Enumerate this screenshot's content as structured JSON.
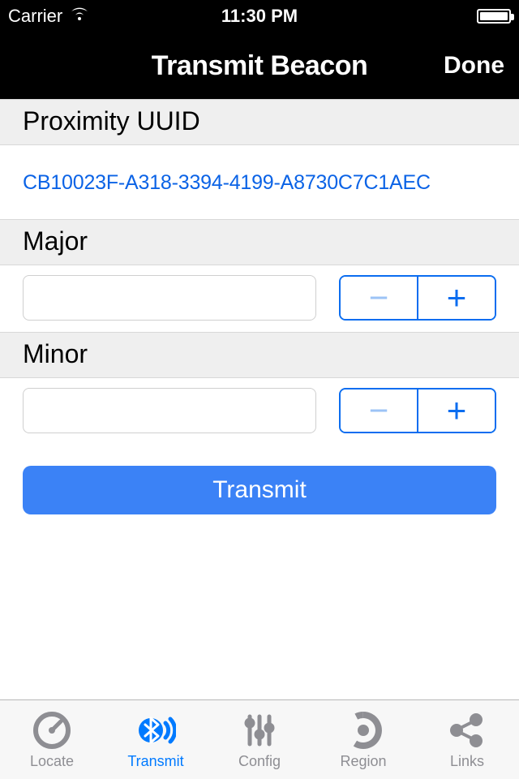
{
  "status": {
    "carrier": "Carrier",
    "time": "11:30 PM"
  },
  "nav": {
    "title": "Transmit Beacon",
    "done": "Done"
  },
  "sections": {
    "proximity": "Proximity UUID",
    "major": "Major",
    "minor": "Minor"
  },
  "uuid": "CB10023F-A318-3394-4199-A8730C7C1AEC",
  "major": {
    "value": ""
  },
  "minor": {
    "value": ""
  },
  "buttons": {
    "transmit": "Transmit"
  },
  "tabs": [
    {
      "key": "locate",
      "label": "Locate",
      "active": false
    },
    {
      "key": "transmit",
      "label": "Transmit",
      "active": true
    },
    {
      "key": "config",
      "label": "Config",
      "active": false
    },
    {
      "key": "region",
      "label": "Region",
      "active": false
    },
    {
      "key": "links",
      "label": "Links",
      "active": false
    }
  ],
  "colors": {
    "accent": "#007aff",
    "buttonBlue": "#3b82f6",
    "link": "#0b63e6",
    "inactive": "#8e8e93"
  }
}
